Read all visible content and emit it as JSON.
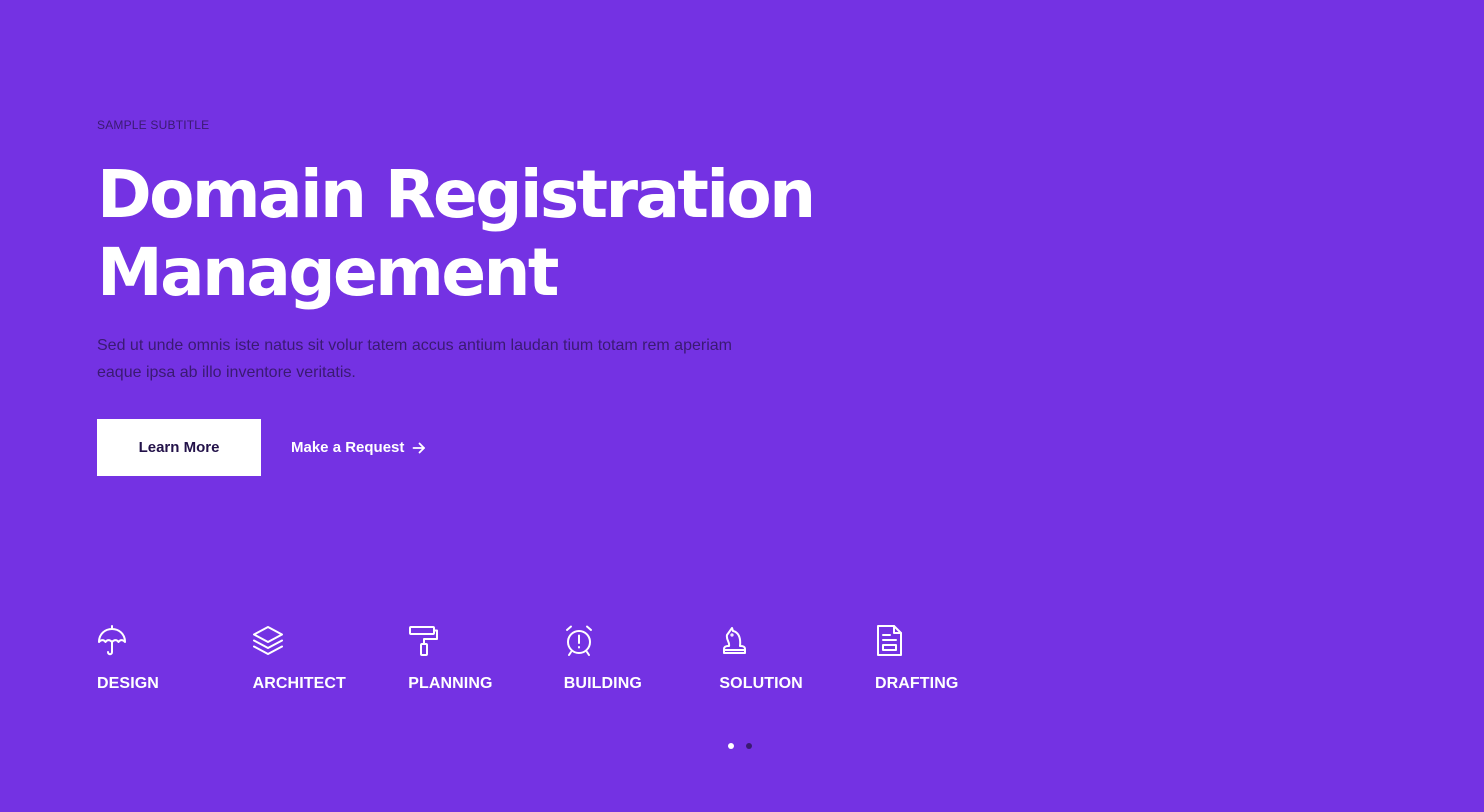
{
  "hero": {
    "subtitle": "SAMPLE SUBTITLE",
    "title_line1": "Domain Registration",
    "title_line2": "Management",
    "description": "Sed ut unde omnis iste natus sit volur tatem accus antium laudan tium totam rem aperiam eaque ipsa ab illo inventore veritatis."
  },
  "actions": {
    "primary_label": "Learn More",
    "secondary_label": "Make a Request",
    "secondary_icon": "arrow-right-icon"
  },
  "features": [
    {
      "label": "DESIGN",
      "icon": "umbrella-icon"
    },
    {
      "label": "ARCHITECT",
      "icon": "layers-icon"
    },
    {
      "label": "PLANNING",
      "icon": "paint-roller-icon"
    },
    {
      "label": "BUILDING",
      "icon": "alarm-clock-icon"
    },
    {
      "label": "SOLUTION",
      "icon": "chess-knight-icon"
    },
    {
      "label": "DRAFTING",
      "icon": "document-icon"
    }
  ],
  "pagination": {
    "active_index": 0,
    "count": 2
  },
  "colors": {
    "background": "#7432e3",
    "accent_text": "#3a1a72",
    "button_bg": "#ffffff",
    "button_text": "#231249",
    "dot_active": "#ffffff",
    "dot_inactive": "#3a1a72"
  }
}
